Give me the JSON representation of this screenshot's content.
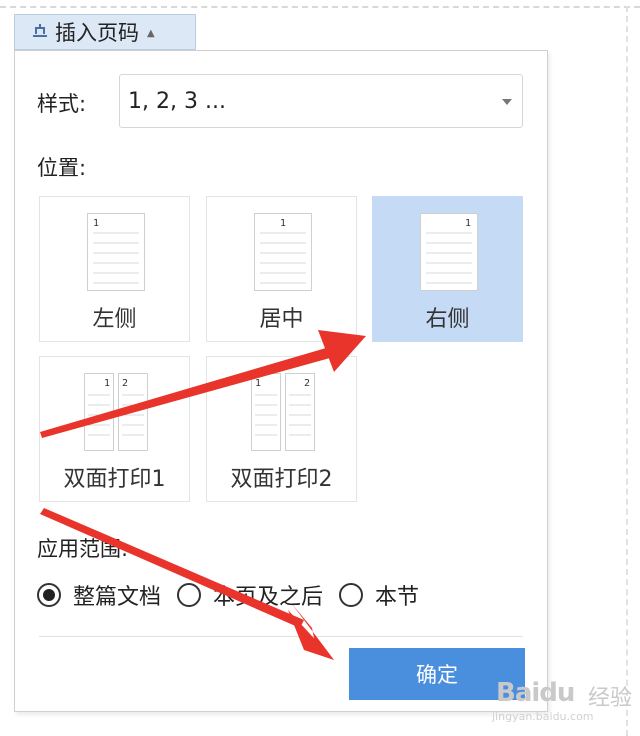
{
  "trigger": {
    "label": "插入页码",
    "icon": "page-number-icon"
  },
  "dialog": {
    "style_label": "样式:",
    "style_value": "1, 2, 3 ...",
    "position_label": "位置:",
    "positions": [
      {
        "label": "左侧",
        "page_number": "1",
        "selected": false
      },
      {
        "label": "居中",
        "page_number": "1",
        "selected": false
      },
      {
        "label": "右侧",
        "page_number": "1",
        "selected": true
      },
      {
        "label": "双面打印1",
        "page_numbers": [
          "1",
          "2"
        ],
        "selected": false
      },
      {
        "label": "双面打印2",
        "page_numbers": [
          "1",
          "2"
        ],
        "selected": false
      }
    ],
    "scope_label": "应用范围:",
    "scope_options": [
      {
        "label": "整篇文档",
        "checked": true
      },
      {
        "label": "本页及之后",
        "checked": false
      },
      {
        "label": "本节",
        "checked": false
      }
    ],
    "ok_label": "确定"
  },
  "annotations": {
    "arrow_color": "#e8342b"
  },
  "colors": {
    "selected_bg": "#c5daf4",
    "button_bg": "#4a8fdd",
    "trigger_bg": "#dce8f6"
  },
  "watermark": {
    "text": "Baidu",
    "sub": "经验",
    "url": "jingyan.baidu.com"
  }
}
